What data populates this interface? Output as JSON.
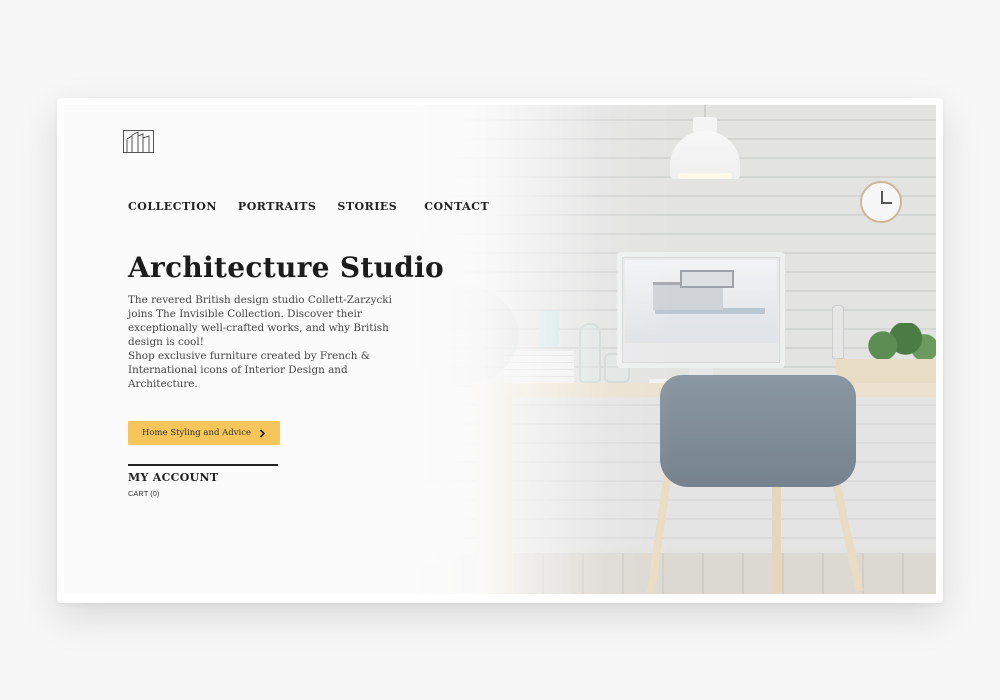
{
  "logo": {
    "icon": "building-columns-icon"
  },
  "nav": {
    "items": [
      {
        "label": "COLLECTION"
      },
      {
        "label": "PORTRAITS"
      },
      {
        "label": "STORIES"
      },
      {
        "label": "CONTACT"
      }
    ]
  },
  "hero": {
    "title": "Architecture Studio",
    "paragraph1": "The revered British design studio Collett-Zarzycki joins The Invisible Collection. Discover their exceptionally well-crafted works, and why British design is cool!",
    "paragraph2": "Shop exclusive furniture created by French & International icons of Interior Design and Architecture.",
    "cta_label": "Home Styling and Advice",
    "cta_icon": "chevron-right-icon"
  },
  "account": {
    "label": "MY ACCOUNT",
    "cart": "CART (0)"
  },
  "colors": {
    "accent": "#f7c65a",
    "text": "#222222",
    "background": "#f7f7f7"
  }
}
